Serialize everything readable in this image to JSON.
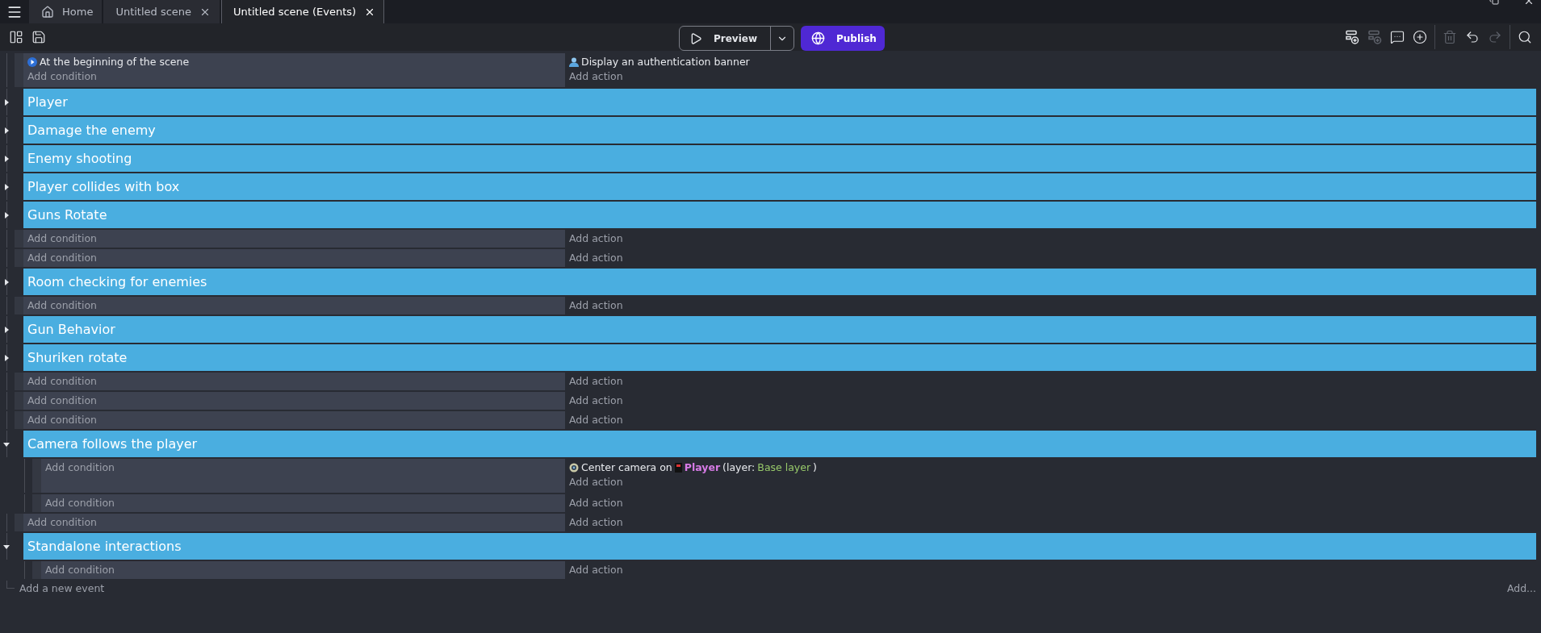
{
  "tabs": [
    {
      "kind": "home",
      "label": "Home",
      "selected": false
    },
    {
      "kind": "scene",
      "label": "Untitled scene",
      "selected": false
    },
    {
      "kind": "scene",
      "label": "Untitled scene (Events)",
      "selected": true
    }
  ],
  "toolbar": {
    "preview": "Preview",
    "publish": "Publish",
    "tools": [
      {
        "kind": "add-event",
        "disabled": false
      },
      {
        "kind": "add-subevent",
        "disabled": true
      },
      {
        "kind": "comment",
        "disabled": false
      },
      {
        "kind": "add",
        "disabled": false
      },
      {
        "kind": "separator"
      },
      {
        "kind": "delete",
        "disabled": true
      },
      {
        "kind": "undo",
        "disabled": false
      },
      {
        "kind": "redo",
        "disabled": true
      },
      {
        "kind": "separator"
      },
      {
        "kind": "search",
        "disabled": false
      }
    ]
  },
  "events": [
    {
      "kind": "standard",
      "conditions": [
        {
          "kind": "start",
          "parts": [
            {
              "kind": "plain",
              "text": "At the beginning of the scene"
            }
          ]
        }
      ],
      "add_condition": "Add condition",
      "actions": [
        {
          "kind": "user",
          "parts": [
            {
              "kind": "plain",
              "text": "Display an authentication banner"
            }
          ]
        }
      ],
      "add_action": "Add action"
    },
    {
      "kind": "group",
      "title": "Player",
      "expanded": false
    },
    {
      "kind": "group",
      "title": "Damage the enemy",
      "expanded": false
    },
    {
      "kind": "group",
      "title": "Enemy shooting",
      "expanded": false
    },
    {
      "kind": "group",
      "title": "Player collides with box",
      "expanded": false
    },
    {
      "kind": "group",
      "title": "Guns Rotate",
      "expanded": false
    },
    {
      "kind": "standard",
      "add_condition": "Add condition",
      "add_action": "Add action"
    },
    {
      "kind": "standard",
      "add_condition": "Add condition",
      "add_action": "Add action"
    },
    {
      "kind": "group",
      "title": "Room checking for enemies",
      "expanded": false
    },
    {
      "kind": "standard",
      "add_condition": "Add condition",
      "add_action": "Add action"
    },
    {
      "kind": "group",
      "title": "Gun Behavior",
      "expanded": false
    },
    {
      "kind": "group",
      "title": "Shuriken rotate",
      "expanded": false
    },
    {
      "kind": "standard",
      "add_condition": "Add condition",
      "add_action": "Add action"
    },
    {
      "kind": "standard",
      "add_condition": "Add condition",
      "add_action": "Add action"
    },
    {
      "kind": "standard",
      "add_condition": "Add condition",
      "add_action": "Add action"
    },
    {
      "kind": "group",
      "title": "Camera follows the player",
      "expanded": true,
      "children": [
        {
          "kind": "standard",
          "add_condition": "Add condition",
          "actions": [
            {
              "kind": "camera",
              "parts": [
                {
                  "kind": "plain",
                  "text": "Center camera on"
                },
                {
                  "kind": "object",
                  "text": "Player"
                },
                {
                  "kind": "plain",
                  "text": "(layer:"
                },
                {
                  "kind": "value",
                  "text": "Base layer"
                },
                {
                  "kind": "plain",
                  "text": ")"
                }
              ]
            }
          ],
          "add_action": "Add action"
        },
        {
          "kind": "standard",
          "add_condition": "Add condition",
          "add_action": "Add action"
        }
      ]
    },
    {
      "kind": "standard",
      "add_condition": "Add condition",
      "add_action": "Add action"
    },
    {
      "kind": "group",
      "title": "Standalone interactions",
      "expanded": true,
      "children": [
        {
          "kind": "standard",
          "add_condition": "Add condition",
          "add_action": "Add action"
        }
      ]
    }
  ],
  "footer": {
    "add_event": "Add a new event",
    "add_more": "Add..."
  }
}
